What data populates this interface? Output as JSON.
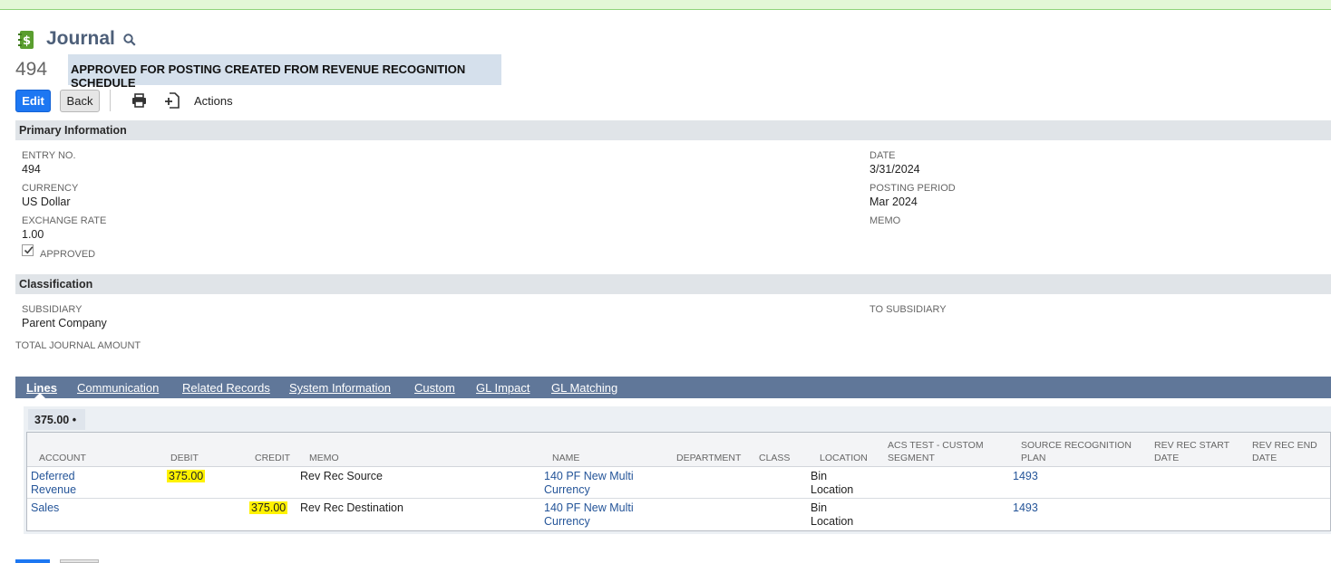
{
  "app": {
    "title": "Journal",
    "icon": "journal-dollar-icon",
    "record_number": "494",
    "memo_banner": "APPROVED FOR POSTING CREATED FROM REVENUE RECOGNITION SCHEDULE"
  },
  "toolbar": {
    "edit_label": "Edit",
    "back_label": "Back",
    "print_icon": "print-icon",
    "new_icon": "new-document-icon",
    "actions_label": "Actions"
  },
  "primary": {
    "section_title": "Primary Information",
    "entry_no_label": "ENTRY NO.",
    "entry_no": "494",
    "currency_label": "CURRENCY",
    "currency": "US Dollar",
    "exchange_rate_label": "EXCHANGE RATE",
    "exchange_rate": "1.00",
    "approved_label": "APPROVED",
    "approved": true,
    "date_label": "DATE",
    "date": "3/31/2024",
    "posting_period_label": "POSTING PERIOD",
    "posting_period": "Mar 2024",
    "memo_label": "MEMO"
  },
  "classification": {
    "section_title": "Classification",
    "subsidiary_label": "SUBSIDIARY",
    "subsidiary": "Parent Company",
    "to_subsidiary_label": "TO SUBSIDIARY",
    "total_journal_amount_label": "TOTAL JOURNAL AMOUNT"
  },
  "tabs": [
    {
      "label": "Lines",
      "active": true
    },
    {
      "label": "Communication"
    },
    {
      "label": "Related Records"
    },
    {
      "label": "System Information"
    },
    {
      "label": "Custom"
    },
    {
      "label": "GL Impact"
    },
    {
      "label": "GL Matching"
    }
  ],
  "lines": {
    "total_chip": "375.00 •",
    "headers": {
      "account": "ACCOUNT",
      "debit": "DEBIT",
      "credit": "CREDIT",
      "memo": "MEMO",
      "name": "NAME",
      "department": "DEPARTMENT",
      "class": "CLASS",
      "location": "LOCATION",
      "acs_line1": "ACS TEST - CUSTOM",
      "acs_line2": "SEGMENT",
      "src_line1": "SOURCE RECOGNITION",
      "src_line2": "PLAN",
      "start_line1": "REV REC START",
      "start_line2": "DATE",
      "end_line1": "REV REC END",
      "end_line2": "DATE"
    },
    "rows": [
      {
        "account_line1": "Deferred",
        "account_line2": "Revenue",
        "debit": "375.00",
        "credit": "",
        "memo": "Rev Rec Source",
        "name_line1": "140 PF New Multi",
        "name_line2": "Currency",
        "location_line1": "Bin",
        "location_line2": "Location",
        "source_plan": "1493"
      },
      {
        "account_line1": "Sales",
        "debit": "",
        "credit": "375.00",
        "memo": "Rev Rec Destination",
        "name_line1": "140 PF New Multi",
        "name_line2": "Currency",
        "location_line1": "Bin",
        "location_line2": "Location",
        "source_plan": "1493"
      }
    ]
  },
  "colors": {
    "primary_button": "#1d77f2",
    "tab_bar": "#607799",
    "highlight": "#fff200",
    "link": "#255599"
  }
}
